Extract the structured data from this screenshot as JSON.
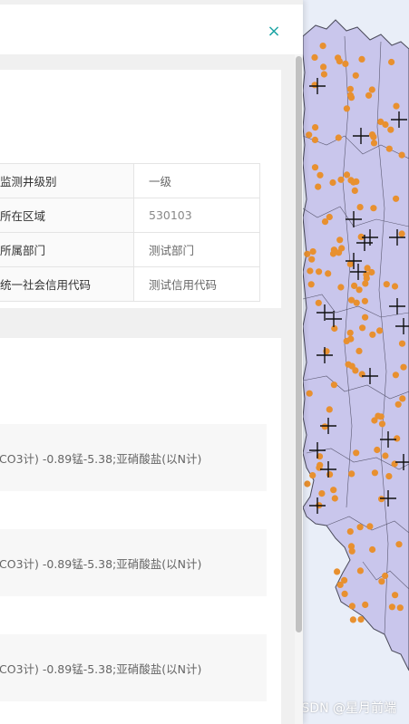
{
  "drawer": {
    "close_label": "×",
    "info_table": {
      "rows": [
        {
          "key": "监测井级别",
          "value": "一级"
        },
        {
          "key": "所在区域",
          "value": "530103"
        },
        {
          "key": "所属部门",
          "value": "测试部门"
        },
        {
          "key": "统一社会信用代码",
          "value": "测试信用代码"
        }
      ]
    },
    "records": [
      {
        "text": "CO3计) -0.89锰-5.38;亚硝酸盐(以N计)"
      },
      {
        "text": "CO3计) -0.89锰-5.38;亚硝酸盐(以N计)"
      },
      {
        "text": "CO3计) -0.89锰-5.38;亚硝酸盐(以N计)"
      }
    ]
  },
  "map": {
    "fill_color": "#c9c6ec",
    "border_color": "#4a4a5a",
    "dot_color": "#e8902f",
    "marker_color": "#111111"
  },
  "watermark": "CSDN @星月前端"
}
